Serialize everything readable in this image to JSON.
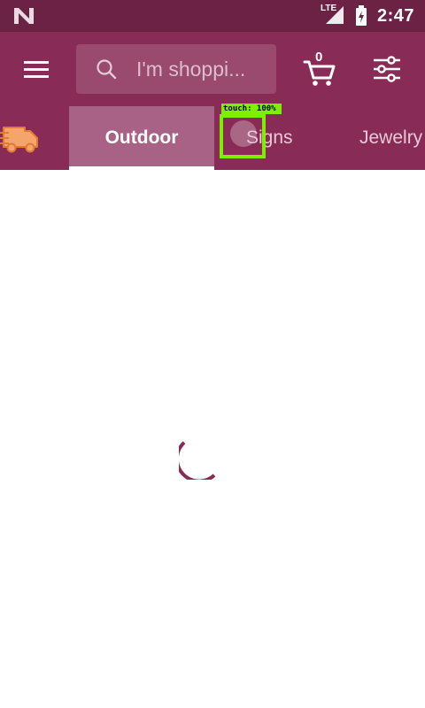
{
  "status_bar": {
    "network": "LTE",
    "time": "2:47"
  },
  "app_bar": {
    "search": {
      "placeholder": "I'm shoppi..."
    },
    "cart": {
      "count": "0"
    }
  },
  "tabs": [
    {
      "label": "Outdoor",
      "active": true
    },
    {
      "label": "Signs",
      "active": false
    },
    {
      "label": "Jewelry",
      "active": false
    }
  ],
  "overlay": {
    "touch_label": "touch: 100%"
  },
  "colors": {
    "status_bar": "#6b2245",
    "primary": "#892b57",
    "active_tab": "#a86285",
    "spinner": "#892b57",
    "touch_overlay": "#7cf000"
  },
  "icons": [
    "n-logo-icon",
    "lte-signal-icon",
    "battery-charging-icon",
    "menu-icon",
    "search-icon",
    "cart-icon",
    "filter-sliders-icon",
    "delivery-truck-icon",
    "loading-spinner-icon"
  ]
}
